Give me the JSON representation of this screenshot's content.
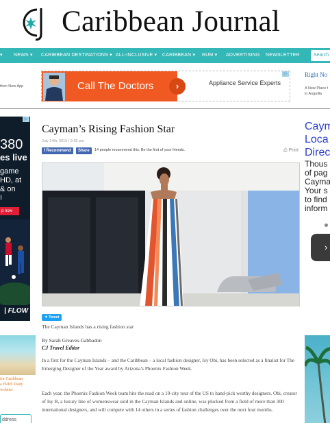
{
  "site": {
    "name": "Caribbean Journal",
    "logo_letters": "CJ"
  },
  "nav": {
    "items": [
      {
        "label": "NEWS ▾"
      },
      {
        "label": "CARIBBEAN DESTINATIONS ▾"
      },
      {
        "label": "ALL-INCLUSIVE ▾"
      },
      {
        "label": "CARIBBEAN ▾"
      },
      {
        "label": "RUM ▾"
      },
      {
        "label": "ADVERTISING"
      },
      {
        "label": "NEWSLETTER"
      }
    ],
    "search_placeholder": "Search"
  },
  "ad_strip": {
    "left_text": "then New App",
    "banner_orange_text": "Call The Doctors",
    "banner_right_text": "Appliance Service Experts",
    "banner_arrow": "›",
    "right_title": "Right No",
    "right_desc_1": "A New Place t",
    "right_desc_2": "in Anguilla"
  },
  "left_ad": {
    "number": "380",
    "subtitle": "es live",
    "lines": [
      "game",
      "HD, at",
      "& on",
      "!"
    ],
    "button": "p now",
    "brand": "| FLOW"
  },
  "newsletter": {
    "line1": "for Caribbean",
    "line2": "a FREE Daily",
    "line3": "wsletter",
    "input_placeholder": "ddress"
  },
  "article": {
    "title": "Cayman’s Rising Fashion Star",
    "date": "July 14th, 2016 | 9:35 pm",
    "fb_recommend": "Recommend",
    "fb_share": "Share",
    "fb_text": "14 people recommend this. Be the first of your friends.",
    "print": "Print",
    "tweet": "Tweet",
    "caption": "The Cayman Islands has a rising fashion star",
    "byline": "By Sarah Greaves-Gabbadon",
    "byline_role": "CJ Travel Editor",
    "paragraphs": [
      "In a first for the Cayman Islands – and the Caribbean – a local fashion designer, Isy Obi, has been selected as a finalist for The Emerging Designer of the Year award by Arizona’s Phoenix Fashion Week.",
      "Each year, the Phoenix Fashion Week team hits the road on a 10-city tour of the US to hand-pick worthy designers. Obi, creator of Isy B, a luxury line of womenswear sold in the Cayman Islands and online, was plucked from a field of more than 300 international designers, and will compete with 14 others in a series of fashion challenges over the next four months."
    ]
  },
  "right_rail": {
    "title_lines": [
      "Caym",
      "Loca",
      "Direc"
    ],
    "text_lines": [
      "Thous",
      "of pag",
      "Cayma",
      "Your s",
      "to find",
      "inform"
    ],
    "button_arrow": "›"
  },
  "colors": {
    "nav": "#34b7b7",
    "ad_orange": "#f05a22",
    "link_blue": "#2a3fd0",
    "newsletter_orange": "#e07a20"
  }
}
